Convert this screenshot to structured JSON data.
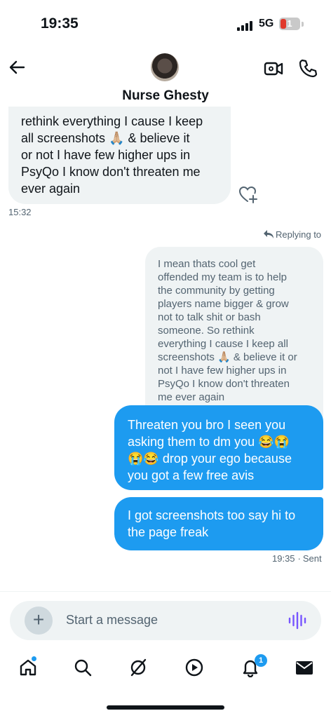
{
  "status_bar": {
    "time": "19:35",
    "network": "5G",
    "battery": "1"
  },
  "header": {
    "contact_name": "Nurse Ghesty",
    "back_icon": "arrow-left-icon",
    "video_icon": "video-camera-icon",
    "phone_icon": "phone-icon"
  },
  "conversation": {
    "incoming": {
      "text": "rethink everything I cause I keep\nall screenshots 🙏🏼 & believe it\nor not I have few higher ups in\nPsyQo I know don't threaten me\never again",
      "timestamp": "15:32",
      "react_icon": "heart-plus-icon"
    },
    "reply_label": "Replying to",
    "quoted_message": "I mean thats cool get\noffended my team is to help\nthe community by getting\nplayers name bigger & grow\nnot to talk shit or bash\nsomeone. So rethink\neverything I cause I keep all\nscreenshots 🙏🏼 & believe it or\nnot I have few higher ups in\nPsyQo I know don't threaten\nme ever again",
    "outgoing": [
      {
        "text": "Threaten you bro I seen you\nasking them to dm you 😂😭\n😭😂 drop your ego because\nyou got a few free avis"
      },
      {
        "text": "I got screenshots too say hi to\nthe page freak"
      }
    ],
    "outgoing_timestamp": "19:35",
    "outgoing_status": "Sent"
  },
  "composer": {
    "placeholder": "Start a message",
    "plus_icon": "plus-icon",
    "voice_icon": "voice-waveform-icon"
  },
  "tabbar": {
    "items": [
      "home",
      "search",
      "grok",
      "video",
      "notifications",
      "messages"
    ],
    "notifications_badge": "1"
  },
  "colors": {
    "accent": "#1d9bf0",
    "bubble_gray": "#eff3f4",
    "text_secondary": "#536471",
    "voice": "#7856ff"
  }
}
